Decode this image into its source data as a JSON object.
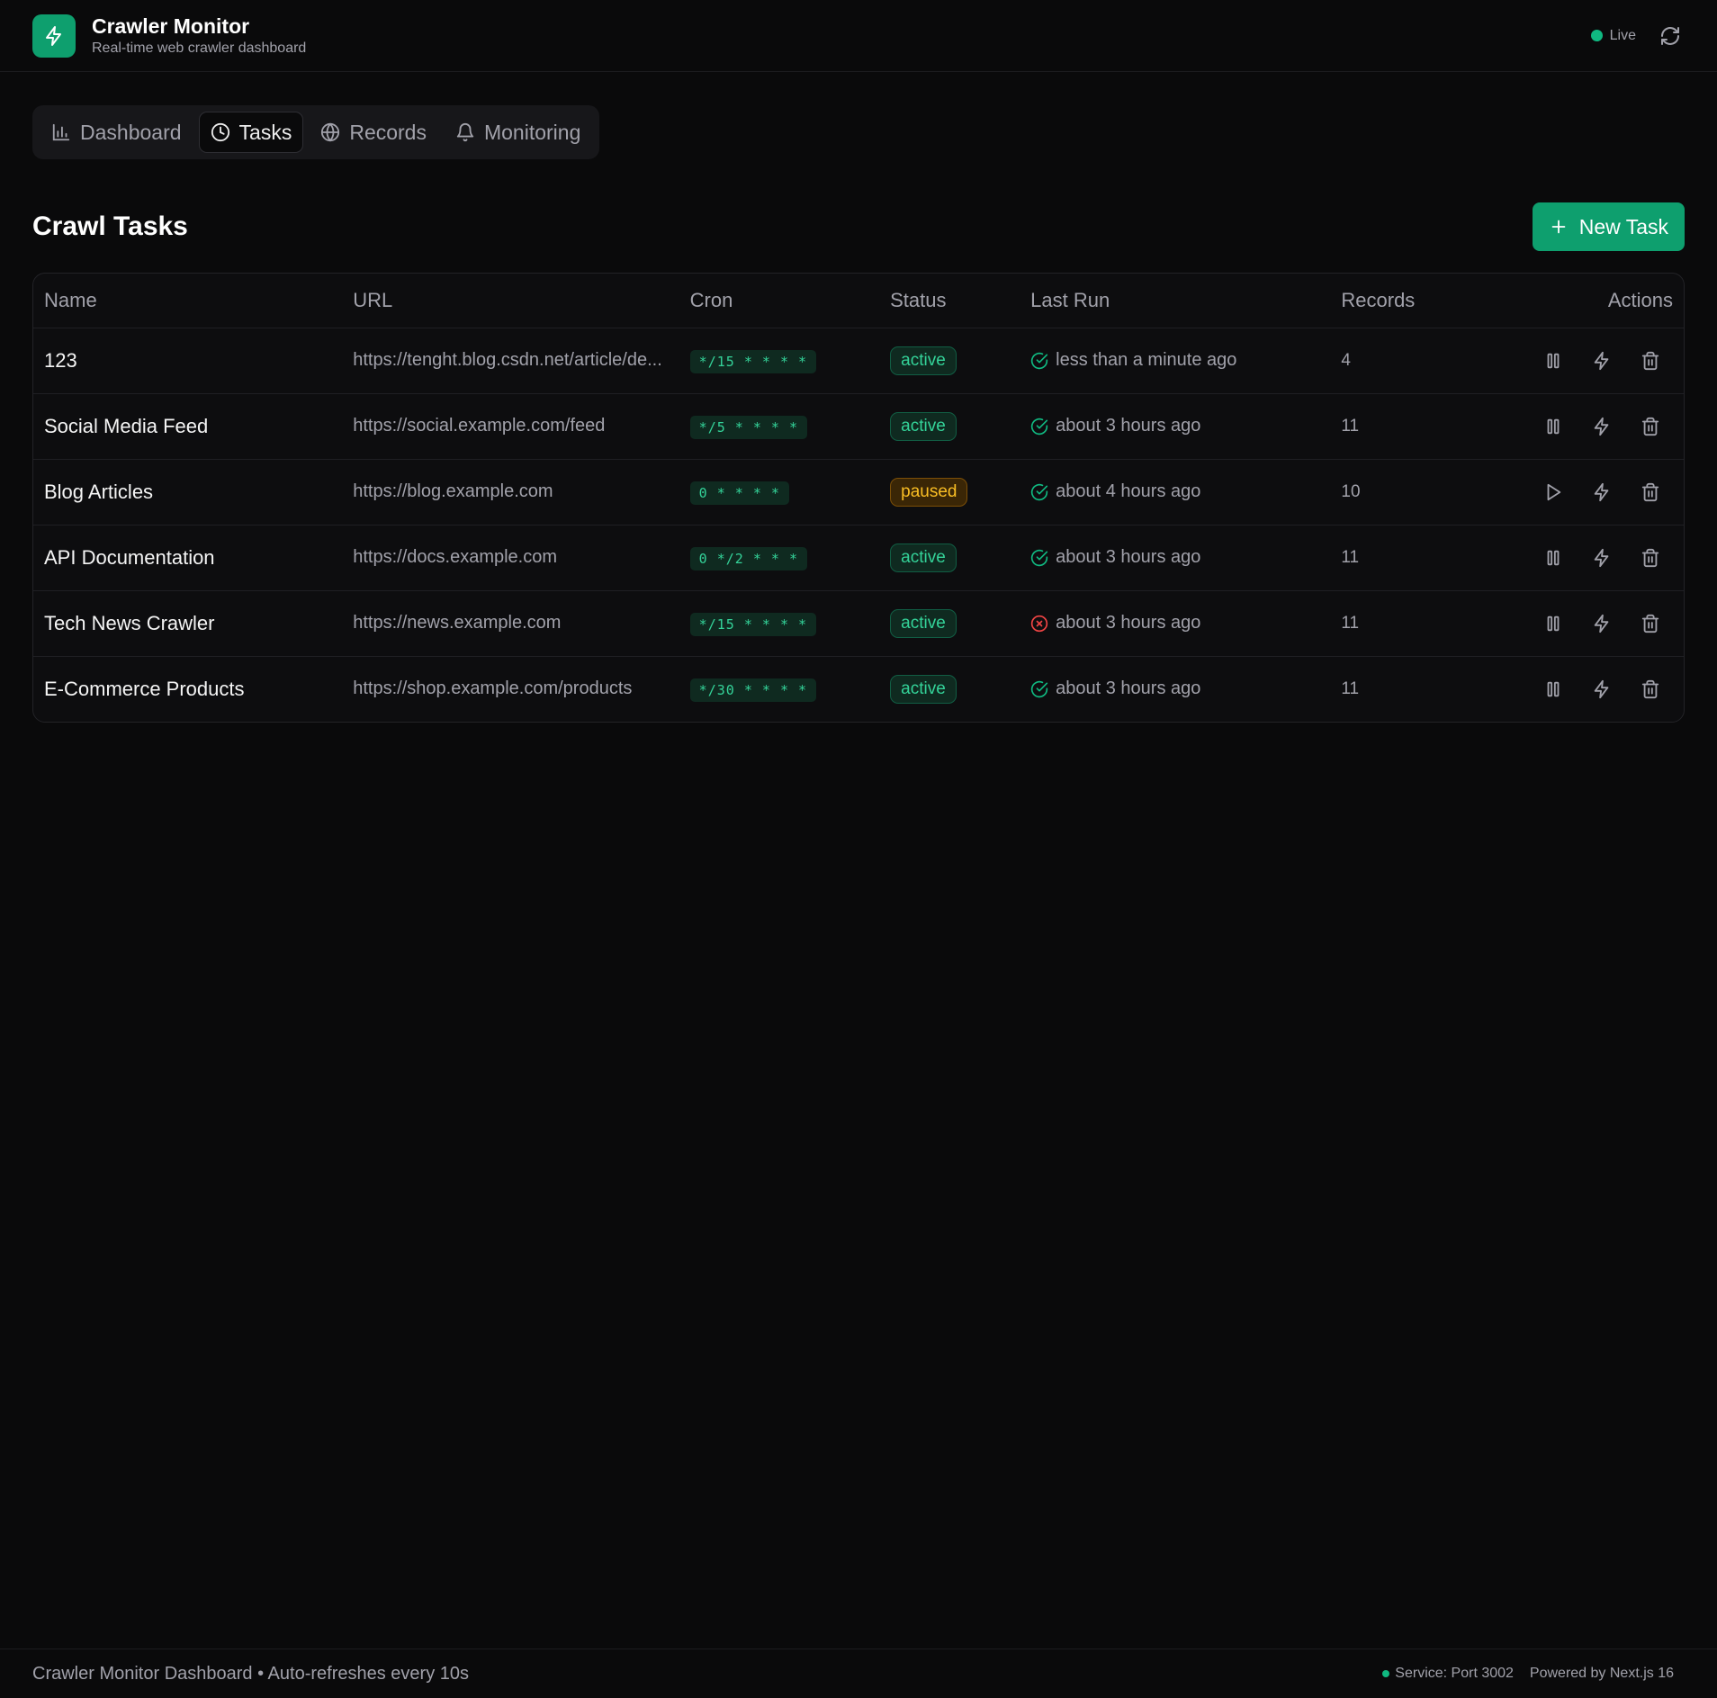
{
  "app": {
    "title": "Crawler Monitor",
    "subtitle": "Real-time web crawler dashboard",
    "live_label": "Live",
    "accent_color": "#0e9f6e"
  },
  "tabs": [
    {
      "label": "Dashboard",
      "icon": "bar-chart-icon",
      "active": false
    },
    {
      "label": "Tasks",
      "icon": "clock-icon",
      "active": true
    },
    {
      "label": "Records",
      "icon": "globe-icon",
      "active": false
    },
    {
      "label": "Monitoring",
      "icon": "bell-icon",
      "active": false
    }
  ],
  "page": {
    "title": "Crawl Tasks",
    "new_task_label": "New Task"
  },
  "table": {
    "columns": [
      "Name",
      "URL",
      "Cron",
      "Status",
      "Last Run",
      "Records",
      "Actions"
    ],
    "rows": [
      {
        "name": "123",
        "url": "https://tenght.blog.csdn.net/article/de...",
        "cron": "*/15 * * * *",
        "status": "active",
        "last_run_ok": true,
        "last_run": "less than a minute ago",
        "records": "4",
        "primary_action": "pause"
      },
      {
        "name": "Social Media Feed",
        "url": "https://social.example.com/feed",
        "cron": "*/5 * * * *",
        "status": "active",
        "last_run_ok": true,
        "last_run": "about 3 hours ago",
        "records": "11",
        "primary_action": "pause"
      },
      {
        "name": "Blog Articles",
        "url": "https://blog.example.com",
        "cron": "0 * * * *",
        "status": "paused",
        "last_run_ok": true,
        "last_run": "about 4 hours ago",
        "records": "10",
        "primary_action": "play"
      },
      {
        "name": "API Documentation",
        "url": "https://docs.example.com",
        "cron": "0 */2 * * *",
        "status": "active",
        "last_run_ok": true,
        "last_run": "about 3 hours ago",
        "records": "11",
        "primary_action": "pause"
      },
      {
        "name": "Tech News Crawler",
        "url": "https://news.example.com",
        "cron": "*/15 * * * *",
        "status": "active",
        "last_run_ok": false,
        "last_run": "about 3 hours ago",
        "records": "11",
        "primary_action": "pause"
      },
      {
        "name": "E-Commerce Products",
        "url": "https://shop.example.com/products",
        "cron": "*/30 * * * *",
        "status": "active",
        "last_run_ok": true,
        "last_run": "about 3 hours ago",
        "records": "11",
        "primary_action": "pause"
      }
    ]
  },
  "footer": {
    "left": "Crawler Monitor Dashboard • Auto-refreshes every 10s",
    "service": "Service: Port 3002",
    "powered": "Powered by Next.js 16"
  }
}
